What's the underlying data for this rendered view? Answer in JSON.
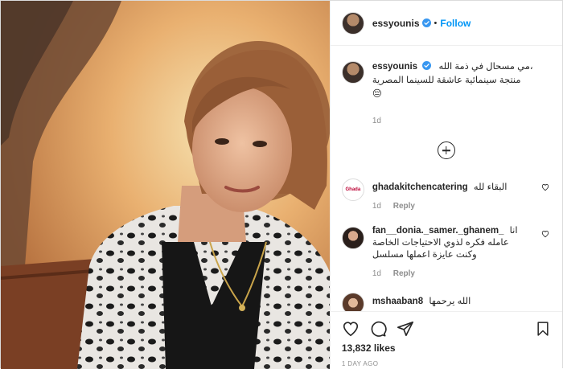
{
  "header": {
    "username": "essyounis",
    "separator": "•",
    "follow_label": "Follow"
  },
  "caption": {
    "username": "essyounis",
    "line1": "مي مسحال في ذمة الله،",
    "line2": "منتجة سينمائية عاشقة للسينما المصرية",
    "emoji": "😔",
    "time": "1d"
  },
  "comments": [
    {
      "username": "ghadakitchencatering",
      "avatar_text": "Ghada",
      "text": "البقاء لله",
      "time": "1d",
      "reply_label": "Reply"
    },
    {
      "username": "fan__donia._samer._ghanem_",
      "text_line1": "انا",
      "text_line2": "عامله فكره لذوي الاحتياجات الخاصة",
      "text_line3": "وكنت عايزة اعملها مسلسل",
      "time": "1d",
      "reply_label": "Reply"
    },
    {
      "username": "mshaaban8",
      "text": "الله يرحمها"
    }
  ],
  "footer": {
    "likes": "13,832 likes",
    "time_ago": "1 DAY AGO"
  },
  "icons": {
    "verified_color": "#3897f0",
    "accent": "#0095f6"
  }
}
